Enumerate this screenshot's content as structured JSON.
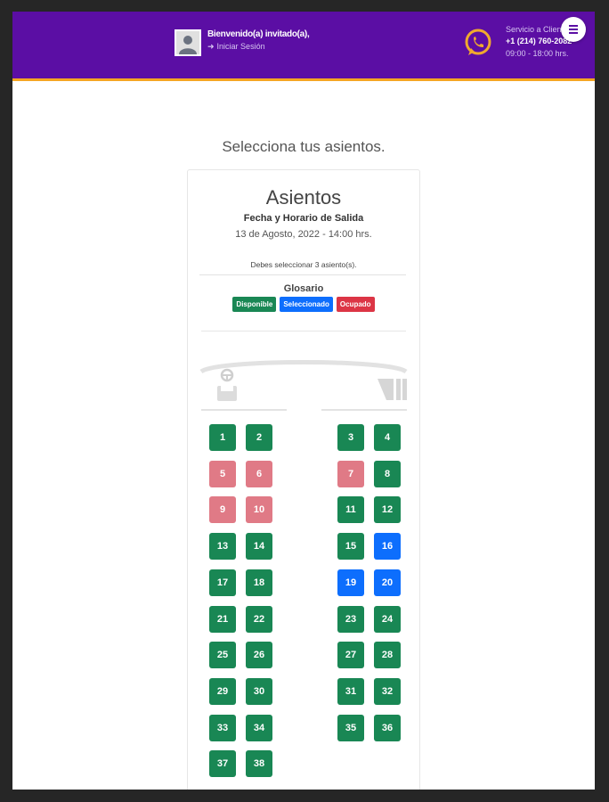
{
  "header": {
    "welcome": "Bienvenido(a) invitado(a),",
    "login_arrow": "➜",
    "login": "Iniciar Sesión",
    "service_label": "Servicio a Clientes",
    "service_phone": "+1 (214) 760-2082",
    "service_hours": "09:00 - 18:00 hrs."
  },
  "page": {
    "title": "Selecciona tus asientos."
  },
  "card": {
    "title": "Asientos",
    "departure_label": "Fecha y Horario de Salida",
    "departure_value": "13 de Agosto, 2022 - 14:00 hrs.",
    "instruction": "Debes seleccionar 3 asiento(s).",
    "glossary_title": "Glosario",
    "legend": [
      {
        "key": "available",
        "label": "Disponible"
      },
      {
        "key": "selected",
        "label": "Seleccionado"
      },
      {
        "key": "occupied",
        "label": "Ocupado"
      }
    ]
  },
  "colors": {
    "header": "#5b0ea4",
    "header_underline": "#f5a623",
    "available": "#198754",
    "selected": "#0d6efd",
    "occupied": "#e07a86",
    "occupied_badge": "#dc3545",
    "whatsapp": "#f0a92e"
  },
  "icons": [
    "avatar-icon",
    "login-arrow-icon",
    "whatsapp-icon",
    "menu-icon",
    "steering-wheel-icon",
    "door-icon"
  ],
  "seats": [
    {
      "number": "1",
      "status": "available"
    },
    {
      "number": "2",
      "status": "available"
    },
    {
      "number": "3",
      "status": "available"
    },
    {
      "number": "4",
      "status": "available"
    },
    {
      "number": "5",
      "status": "occupied"
    },
    {
      "number": "6",
      "status": "occupied"
    },
    {
      "number": "7",
      "status": "occupied"
    },
    {
      "number": "8",
      "status": "available"
    },
    {
      "number": "9",
      "status": "occupied"
    },
    {
      "number": "10",
      "status": "occupied"
    },
    {
      "number": "11",
      "status": "available"
    },
    {
      "number": "12",
      "status": "available"
    },
    {
      "number": "13",
      "status": "available"
    },
    {
      "number": "14",
      "status": "available"
    },
    {
      "number": "15",
      "status": "available"
    },
    {
      "number": "16",
      "status": "selected"
    },
    {
      "number": "17",
      "status": "available"
    },
    {
      "number": "18",
      "status": "available"
    },
    {
      "number": "19",
      "status": "selected"
    },
    {
      "number": "20",
      "status": "selected"
    },
    {
      "number": "21",
      "status": "available"
    },
    {
      "number": "22",
      "status": "available"
    },
    {
      "number": "23",
      "status": "available"
    },
    {
      "number": "24",
      "status": "available"
    },
    {
      "number": "25",
      "status": "available"
    },
    {
      "number": "26",
      "status": "available"
    },
    {
      "number": "27",
      "status": "available"
    },
    {
      "number": "28",
      "status": "available"
    },
    {
      "number": "29",
      "status": "available"
    },
    {
      "number": "30",
      "status": "available"
    },
    {
      "number": "31",
      "status": "available"
    },
    {
      "number": "32",
      "status": "available"
    },
    {
      "number": "33",
      "status": "available"
    },
    {
      "number": "34",
      "status": "available"
    },
    {
      "number": "35",
      "status": "available"
    },
    {
      "number": "36",
      "status": "available"
    },
    {
      "number": "37",
      "status": "available"
    },
    {
      "number": "38",
      "status": "available"
    }
  ]
}
